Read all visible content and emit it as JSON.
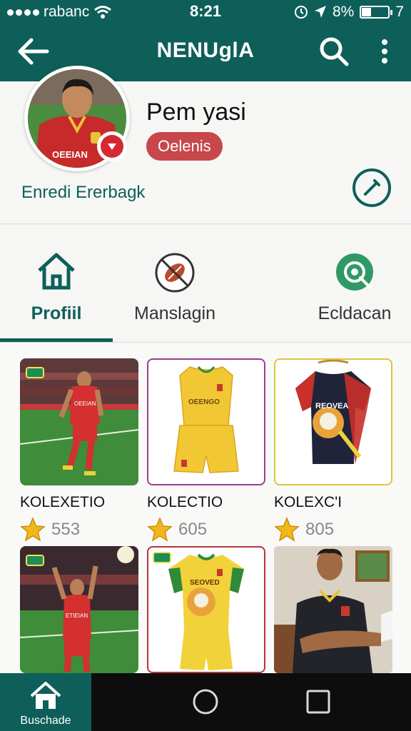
{
  "status": {
    "carrier": "rabanc",
    "time": "8:21",
    "battery_percent": "8%",
    "battery_level": 0.35,
    "extra": "7"
  },
  "app_bar": {
    "title": "NENUglA",
    "back_icon": "arrow-left-icon",
    "search_icon": "search-icon",
    "more_icon": "more-vertical-icon"
  },
  "profile": {
    "name": "Pem yasi",
    "pill": "Oelenis",
    "subtitle": "Enredi Ererbagk",
    "avatar_jersey_text": "OEEIAN",
    "edit_icon": "edit-icon"
  },
  "tabs": [
    {
      "label": "Profiil",
      "icon": "home-icon",
      "active": true
    },
    {
      "label": "Manslagin",
      "icon": "ball-icon",
      "active": false
    },
    {
      "label": "Ecldacan",
      "icon": "target-icon",
      "active": false
    }
  ],
  "grid": [
    {
      "name": "KOLEXETIO",
      "count": "553",
      "kind": "player-photo",
      "jersey_text": "OEEIAN"
    },
    {
      "name": "KOLECTIO",
      "count": "605",
      "kind": "yellow-kit",
      "jersey_text": "OEENGO"
    },
    {
      "name": "KOLEXC'I",
      "count": "805",
      "kind": "dark-kit",
      "jersey_text": "REOVEA"
    },
    {
      "name": "",
      "count": "",
      "kind": "player-celebrating",
      "jersey_text": "ETIEIAN"
    },
    {
      "name": "",
      "count": "",
      "kind": "yellow-kit-2",
      "jersey_text": "SEOVED"
    },
    {
      "name": "",
      "count": "",
      "kind": "man-photo",
      "jersey_text": ""
    }
  ],
  "bottom_nav": {
    "home_label": "Buschade",
    "home_icon": "home-icon",
    "circle_icon": "circle-home-icon",
    "square_icon": "recent-apps-icon"
  },
  "colors": {
    "primary": "#0e5f5a",
    "pill": "#c8474a",
    "star": "#f2b819"
  }
}
